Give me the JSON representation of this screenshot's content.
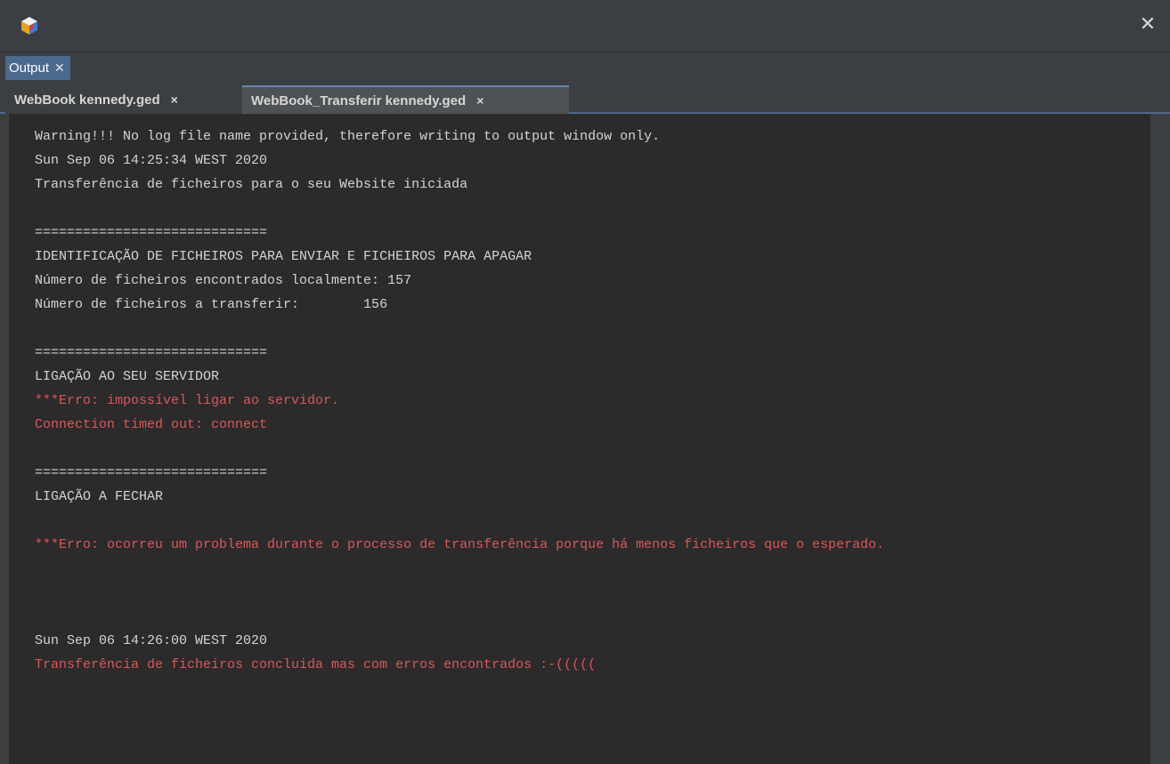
{
  "window": {
    "close_glyph": "✕",
    "logo_icon": "app-cube-logo"
  },
  "output_tab": {
    "label": "Output",
    "close_glyph": "✕"
  },
  "file_tabs": [
    {
      "label": "WebBook kennedy.ged",
      "close_glyph": "×",
      "active": false
    },
    {
      "label": "WebBook_Transferir kennedy.ged",
      "close_glyph": "×",
      "active": true
    }
  ],
  "colors": {
    "normal_text": "#d3d3d3",
    "error_text": "#e05555",
    "console_bg": "#2b2b2b",
    "accent": "#4a6a8f"
  },
  "log": [
    {
      "text": "Warning!!! No log file name provided, therefore writing to output window only.",
      "kind": "normal"
    },
    {
      "text": "Sun Sep 06 14:25:34 WEST 2020",
      "kind": "normal"
    },
    {
      "text": "Transferência de ficheiros para o seu Website iniciada",
      "kind": "normal"
    },
    {
      "text": "=============================",
      "kind": "normal"
    },
    {
      "text": "IDENTIFICAÇÃO DE FICHEIROS PARA ENVIAR E FICHEIROS PARA APAGAR",
      "kind": "normal"
    },
    {
      "text": "Número de ficheiros encontrados localmente: 157",
      "kind": "normal"
    },
    {
      "text": "Número de ficheiros a transferir:        156",
      "kind": "normal"
    },
    {
      "text": "=============================",
      "kind": "normal"
    },
    {
      "text": "LIGAÇÃO AO SEU SERVIDOR",
      "kind": "normal"
    },
    {
      "text": "***Erro: impossível ligar ao servidor.",
      "kind": "error"
    },
    {
      "text": "Connection timed out: connect",
      "kind": "error"
    },
    {
      "text": "=============================",
      "kind": "normal"
    },
    {
      "text": "LIGAÇÃO A FECHAR",
      "kind": "normal"
    },
    {
      "text": "***Erro: ocorreu um problema durante o processo de transferência porque há menos ficheiros que o esperado.",
      "kind": "error"
    },
    {
      "text": "Sun Sep 06 14:26:00 WEST 2020",
      "kind": "normal"
    },
    {
      "text": "Transferência de ficheiros concluida mas com erros encontrados :-(((((",
      "kind": "error"
    }
  ]
}
